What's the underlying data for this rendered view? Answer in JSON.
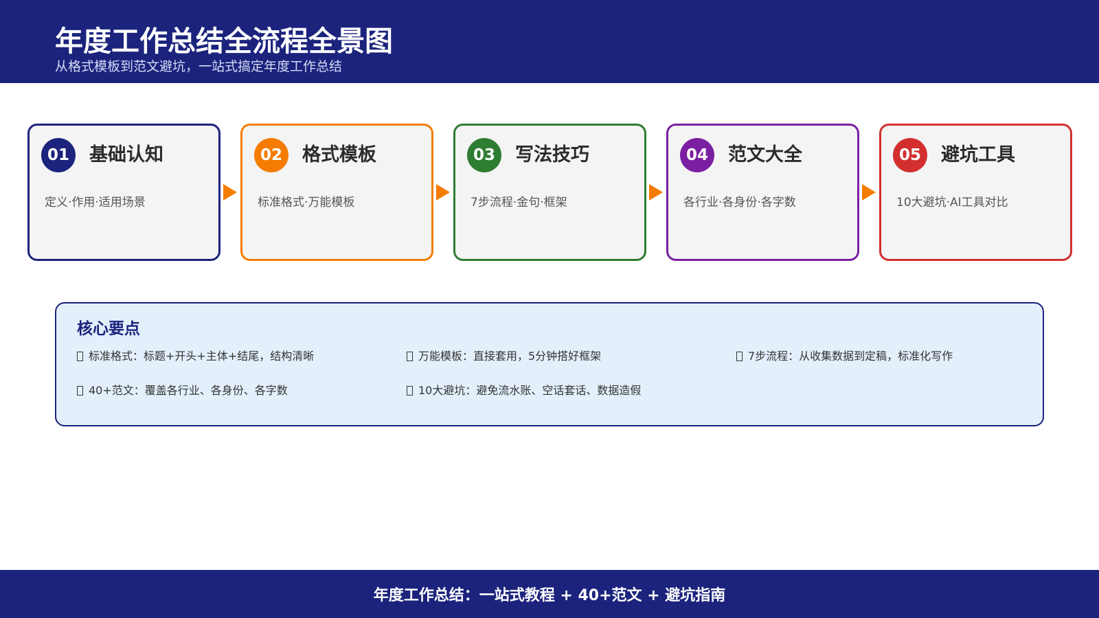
{
  "header": {
    "title": "年度工作总结全流程全景图",
    "subtitle": "从格式模板到范文避坑，一站式搞定年度工作总结"
  },
  "steps": [
    {
      "num": "01",
      "title": "基础认知",
      "desc": "定义·作用·适用场景",
      "color": "#1b237d"
    },
    {
      "num": "02",
      "title": "格式模板",
      "desc": "标准格式·万能模板",
      "color": "#f57c00"
    },
    {
      "num": "03",
      "title": "写法技巧",
      "desc": "7步流程·金句·框架",
      "color": "#2e7d32"
    },
    {
      "num": "04",
      "title": "范文大全",
      "desc": "各行业·各身份·各字数",
      "color": "#7b1fa2"
    },
    {
      "num": "05",
      "title": "避坑工具",
      "desc": "10大避坑·AI工具对比",
      "color": "#d32f2f"
    }
  ],
  "arrow_color": "#f57c00",
  "key_points": {
    "title": "核心要点",
    "items": [
      "标准格式：标题+开头+主体+结尾，结构清晰",
      "万能模板：直接套用，5分钟搭好框架",
      "7步流程：从收集数据到定稿，标准化写作",
      "40+范文：覆盖各行业、各身份、各字数",
      "10大避坑：避免流水账、空话套话、数据造假"
    ]
  },
  "footer": {
    "text": "年度工作总结：一站式教程 + 40+范文 + 避坑指南"
  }
}
